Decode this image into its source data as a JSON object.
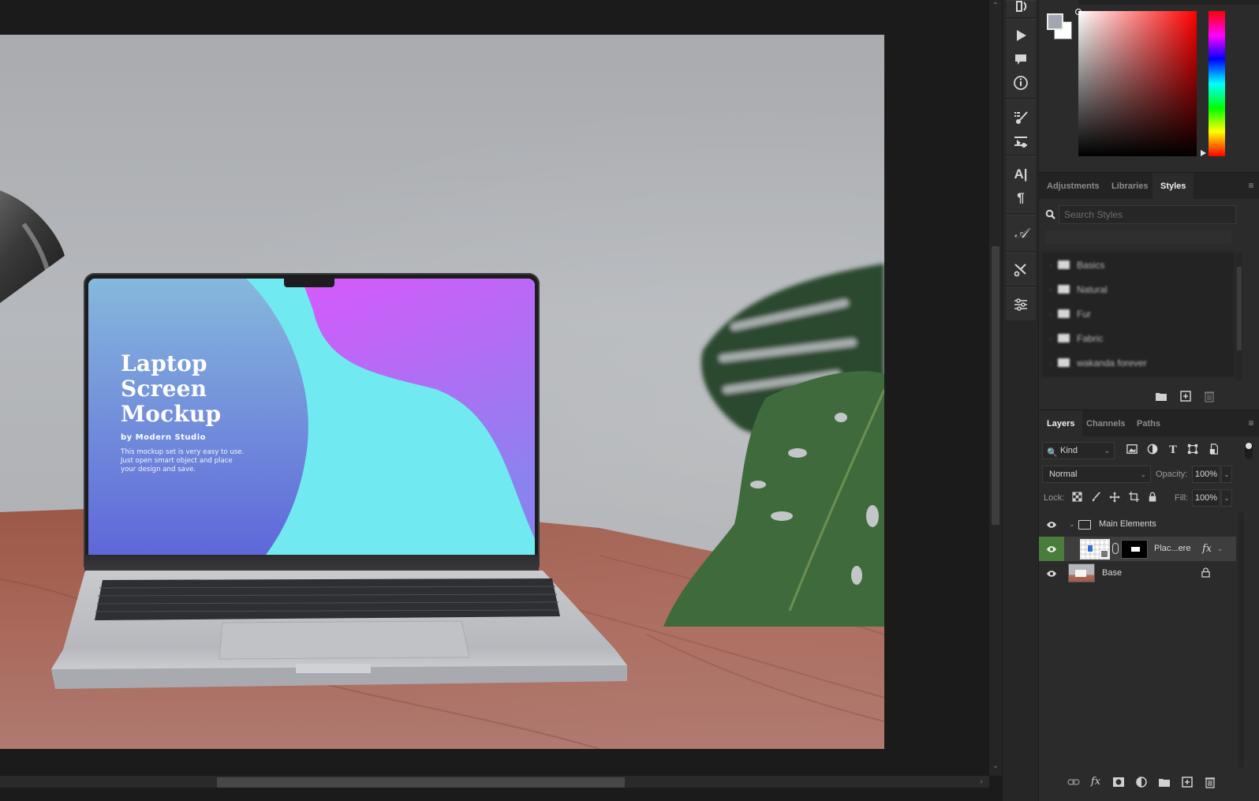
{
  "canvas": {
    "document": {
      "screen_title": "Laptop\nScreen\nMockup",
      "screen_byline": "by Modern Studio",
      "screen_description": "This mockup set is very easy to use. Just open smart object and place your design and save."
    },
    "colors": {
      "workspace": "#1b1b1b",
      "wall": "#b0b2b5",
      "desk": "#a7614f",
      "screen_cyan": "#6fe9f0",
      "screen_purple": "#d05cf5",
      "screen_blue": "#6472dc"
    }
  },
  "scrollbars": {
    "vertical_up": "⌃",
    "vertical_down": "⌄",
    "horizontal_right": "›"
  },
  "toolstrip": {
    "items": [
      {
        "icon": "history-brush-icon"
      },
      {
        "icon": "play-icon",
        "glyph": "▶"
      },
      {
        "icon": "comment-icon"
      },
      {
        "icon": "info-icon"
      },
      {
        "icon": "brush-presets-icon"
      },
      {
        "icon": "brush-settings-icon"
      },
      {
        "icon": "character-icon",
        "glyph": "A|"
      },
      {
        "icon": "paragraph-icon",
        "glyph": "¶"
      },
      {
        "icon": "glyphs-icon",
        "glyph": "𝒜"
      },
      {
        "icon": "tool-presets-icon"
      },
      {
        "icon": "properties-icon"
      }
    ]
  },
  "color_panel": {
    "foreground": "#a3a6b0",
    "background": "#ffffff",
    "hue": "#ff0000"
  },
  "styles_panel": {
    "tabs": [
      {
        "label": "Adjustments",
        "active": false
      },
      {
        "label": "Libraries",
        "active": false
      },
      {
        "label": "Styles",
        "active": true
      }
    ],
    "search_placeholder": "Search Styles",
    "search_value": "",
    "folders": [
      {
        "label": "Basics"
      },
      {
        "label": "Natural"
      },
      {
        "label": "Fur"
      },
      {
        "label": "Fabric"
      },
      {
        "label": "wakanda forever"
      }
    ],
    "footer": {
      "new_group": "new-group-icon",
      "new_style": "new-style-icon",
      "delete": "delete-icon"
    }
  },
  "layers_panel": {
    "tabs": [
      {
        "label": "Layers",
        "active": true
      },
      {
        "label": "Channels",
        "active": false
      },
      {
        "label": "Paths",
        "active": false
      }
    ],
    "filter_kind": "Kind",
    "blend_mode": "Normal",
    "opacity_label": "Opacity:",
    "opacity": "100%",
    "lock_label": "Lock:",
    "fill_label": "Fill:",
    "fill": "100%",
    "layers": [
      {
        "name": "Main Elements",
        "type": "group",
        "visible": true,
        "expanded": true,
        "selected": false
      },
      {
        "name": "Plac...ere",
        "type": "smart-object",
        "visible": true,
        "selected": true,
        "has_mask": true,
        "has_fx": true,
        "fx_label": "fx"
      },
      {
        "name": "Base",
        "type": "pixel",
        "visible": true,
        "selected": false,
        "locked": true
      }
    ],
    "accent": "#4a7c3b"
  }
}
